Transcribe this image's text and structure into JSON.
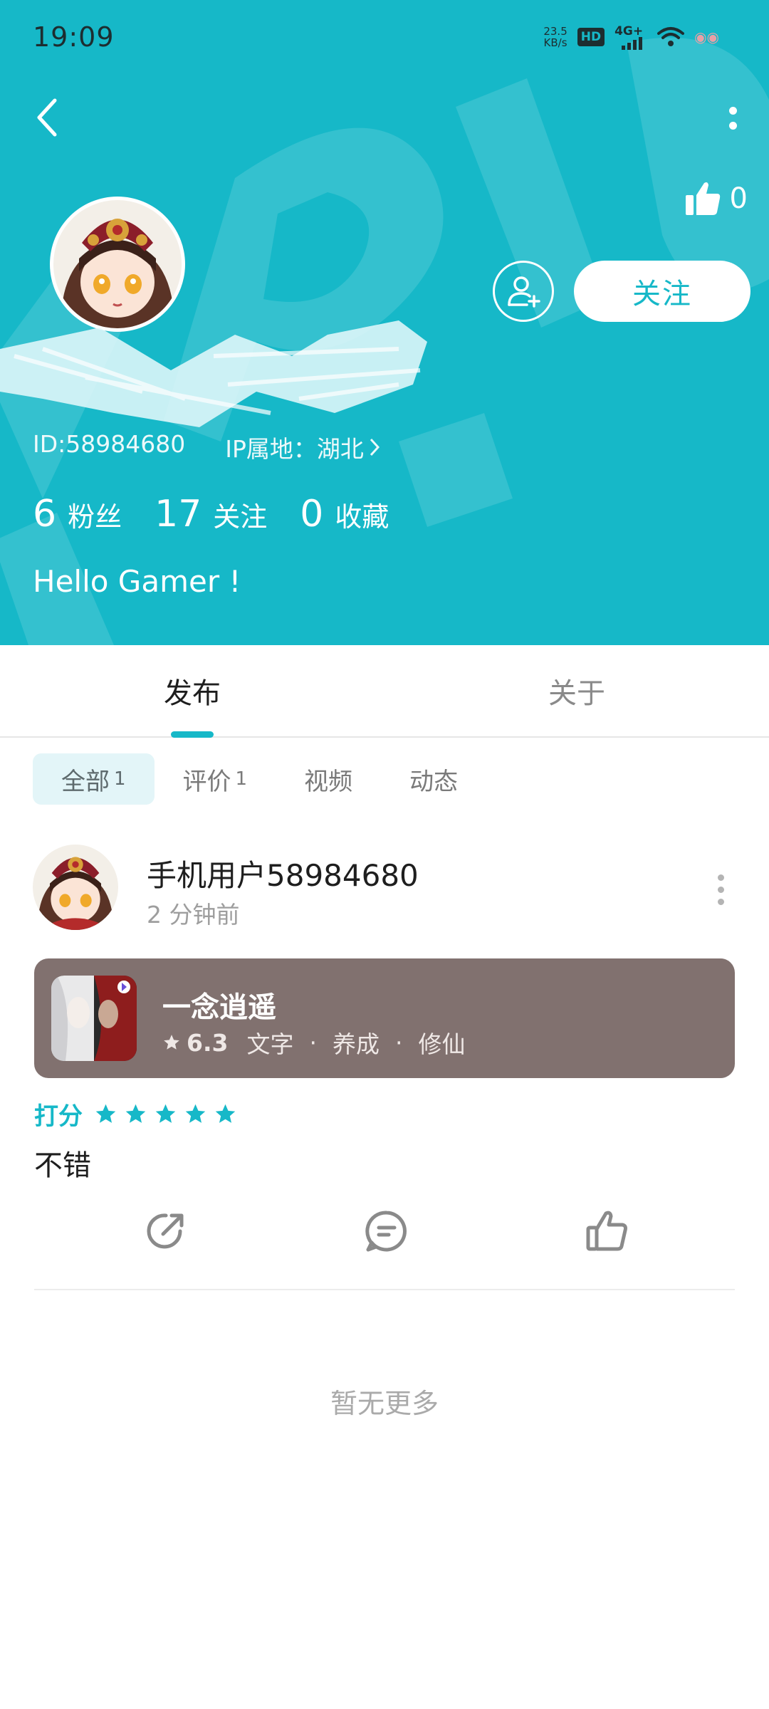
{
  "status_bar": {
    "time": "19:09",
    "net_speed_value": "23.5",
    "net_speed_unit": "KB/s",
    "hd": "HD",
    "network": "4G+"
  },
  "profile": {
    "like_count": "0",
    "follow_label": "关注",
    "id_text": "ID:58984680",
    "ip_text": "IP属地：湖北",
    "bio": "Hello Gamer !",
    "stats": [
      {
        "num": "6",
        "label": "粉丝"
      },
      {
        "num": "17",
        "label": "关注"
      },
      {
        "num": "0",
        "label": "收藏"
      }
    ]
  },
  "tabs": [
    {
      "label": "发布",
      "active": true
    },
    {
      "label": "关于",
      "active": false
    }
  ],
  "filters": [
    {
      "label": "全部",
      "count": "1",
      "active": true
    },
    {
      "label": "评价",
      "count": "1",
      "active": false
    },
    {
      "label": "视频",
      "count": "",
      "active": false
    },
    {
      "label": "动态",
      "count": "",
      "active": false
    }
  ],
  "post": {
    "user_name": "手机用户58984680",
    "time_ago": "2 分钟前",
    "game": {
      "title": "一念逍遥",
      "score": "6.3",
      "tags": [
        "文字",
        "养成",
        "修仙"
      ],
      "separator": "·"
    },
    "rating_label": "打分",
    "rating_stars": 5,
    "review_text": "不错"
  },
  "footer": {
    "no_more_text": "暂无更多"
  },
  "colors": {
    "brand": "#16b8c8",
    "game_card_bg": "#81716f"
  },
  "icons": [
    "back-icon",
    "more-icon",
    "thumbs-up-icon",
    "add-friend-icon",
    "share-icon",
    "comment-icon",
    "star-icon"
  ]
}
